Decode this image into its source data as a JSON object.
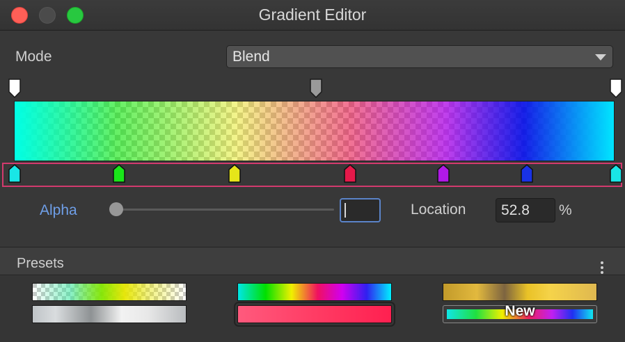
{
  "window": {
    "title": "Gradient Editor",
    "traffic_lights": {
      "close": "#ff5f57",
      "minimize": "#4b4b4b",
      "maximize": "#28c840"
    }
  },
  "mode": {
    "label": "Mode",
    "value": "Blend"
  },
  "alpha_keys": [
    {
      "location_pct": 0,
      "color": "#ffffff"
    },
    {
      "location_pct": 50,
      "color": "#9a9a9a"
    },
    {
      "location_pct": 100,
      "color": "#ffffff"
    }
  ],
  "color_keys": [
    {
      "location_pct": 0,
      "color": "#19e6e6"
    },
    {
      "location_pct": 17.5,
      "color": "#19e619"
    },
    {
      "location_pct": 36.5,
      "color": "#e6e619"
    },
    {
      "location_pct": 55.5,
      "color": "#e6194a"
    },
    {
      "location_pct": 72.5,
      "color": "#b019e6"
    },
    {
      "location_pct": 86.5,
      "color": "#1932e6"
    },
    {
      "location_pct": 100,
      "color": "#19e6e6"
    }
  ],
  "alpha_row": {
    "label": "Alpha",
    "slider_value": 0,
    "field_value": ""
  },
  "location": {
    "label": "Location",
    "value": "52.8",
    "unit": "%"
  },
  "presets": {
    "label": "Presets",
    "new_label": "New"
  },
  "colors": {
    "accent_blue": "#6f9fe8",
    "selection_border": "#d33a6e"
  }
}
